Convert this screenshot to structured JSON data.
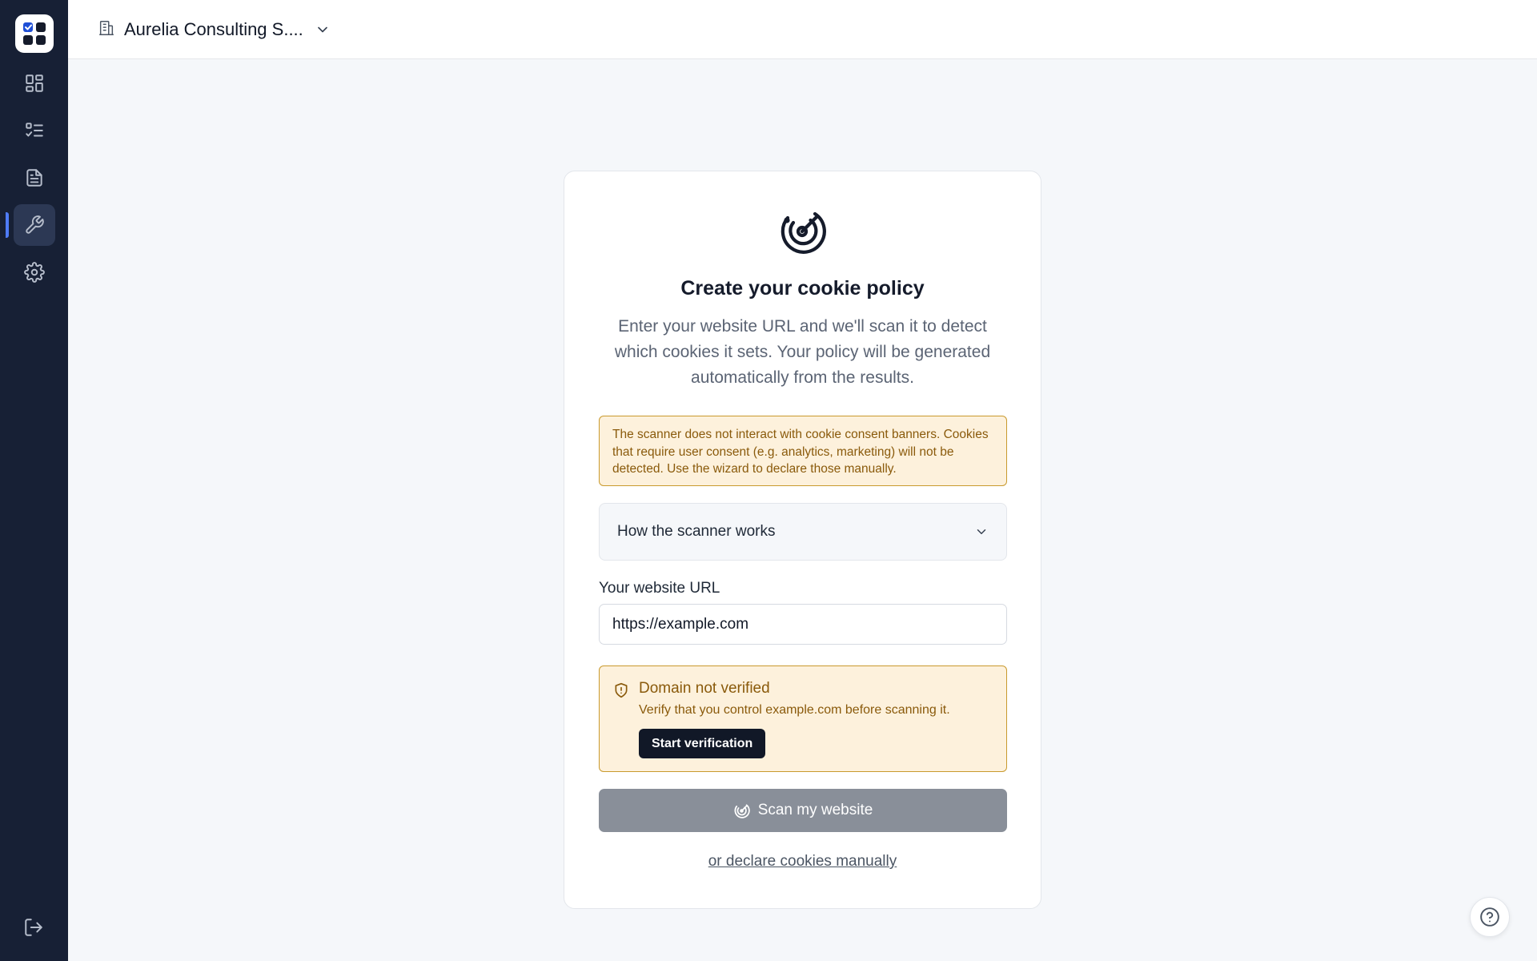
{
  "sidebar": {
    "logo_icon": "app-logo-icon",
    "items": [
      {
        "icon": "dashboard-grid-icon",
        "active": false
      },
      {
        "icon": "checklist-icon",
        "active": false
      },
      {
        "icon": "document-icon",
        "active": false
      },
      {
        "icon": "wrench-icon",
        "active": true
      },
      {
        "icon": "gear-icon",
        "active": false
      }
    ],
    "logout_icon": "logout-icon",
    "accent_color": "#4f7cf7",
    "background": "#172035"
  },
  "topbar": {
    "org_icon": "building-icon",
    "org_name": "Aurelia Consulting S....",
    "chevron_icon": "chevron-down-icon"
  },
  "card": {
    "hero_icon": "radar-icon",
    "title": "Create your cookie policy",
    "subtitle": "Enter your website URL and we'll scan it to detect which cookies it sets. Your policy will be generated automatically from the results.",
    "warning": "The scanner does not interact with cookie consent banners. Cookies that require user consent (e.g. analytics, marketing) will not be detected. Use the wizard to declare those manually.",
    "accordion_label": "How the scanner works",
    "url_label": "Your website URL",
    "url_value": "https://example.com",
    "domain": {
      "icon": "shield-alert-icon",
      "title": "Domain not verified",
      "description": "Verify that you control example.com before scanning it.",
      "button_label": "Start verification"
    },
    "scan_button_label": "Scan my website",
    "manual_link": "or declare cookies manually"
  },
  "help_icon": "help-circle-icon",
  "colors": {
    "warning_bg": "#fdf1dc",
    "warning_border": "#c99a2e",
    "warning_text": "#8a5a0b",
    "disabled_button": "#898f99"
  }
}
